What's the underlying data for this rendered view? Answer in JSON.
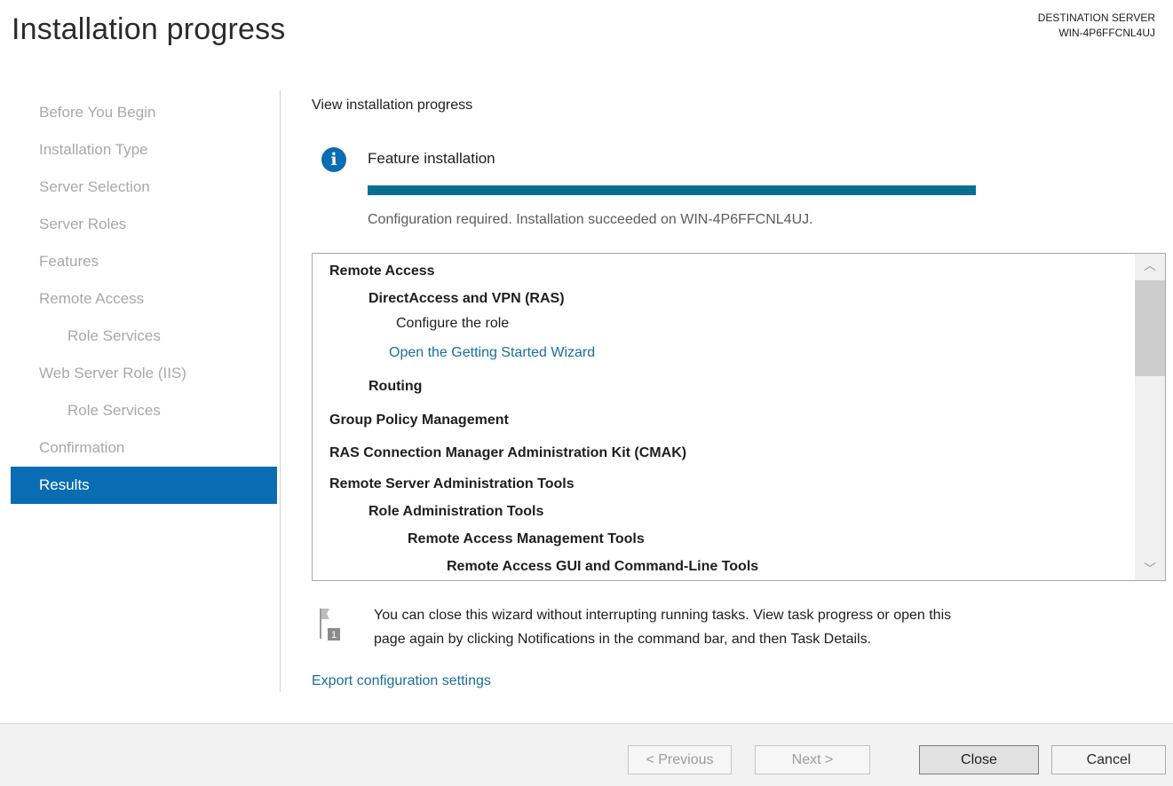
{
  "header": {
    "title": "Installation progress",
    "destination_label": "DESTINATION SERVER",
    "destination_server": "WIN-4P6FFCNL4UJ"
  },
  "nav": {
    "items": [
      {
        "label": "Before You Begin",
        "sub": false,
        "active": false
      },
      {
        "label": "Installation Type",
        "sub": false,
        "active": false
      },
      {
        "label": "Server Selection",
        "sub": false,
        "active": false
      },
      {
        "label": "Server Roles",
        "sub": false,
        "active": false
      },
      {
        "label": "Features",
        "sub": false,
        "active": false
      },
      {
        "label": "Remote Access",
        "sub": false,
        "active": false
      },
      {
        "label": "Role Services",
        "sub": true,
        "active": false
      },
      {
        "label": "Web Server Role (IIS)",
        "sub": false,
        "active": false
      },
      {
        "label": "Role Services",
        "sub": true,
        "active": false
      },
      {
        "label": "Confirmation",
        "sub": false,
        "active": false
      },
      {
        "label": "Results",
        "sub": false,
        "active": true
      }
    ]
  },
  "main": {
    "heading": "View installation progress",
    "feature_label": "Feature installation",
    "progress_percent": 100,
    "status": "Configuration required. Installation succeeded on WIN-4P6FFCNL4UJ.",
    "results": [
      {
        "text": "Remote Access",
        "level": 0,
        "style": "bold"
      },
      {
        "text": "DirectAccess and VPN (RAS)",
        "level": 1,
        "style": "bold"
      },
      {
        "text": "Configure the role",
        "level": 2,
        "style": "normal"
      },
      {
        "text": "Open the Getting Started Wizard",
        "level": 3,
        "style": "link"
      },
      {
        "text": "Routing",
        "level": 1,
        "style": "bold"
      },
      {
        "text": "Group Policy Management",
        "level": 0,
        "style": "bold"
      },
      {
        "text": "RAS Connection Manager Administration Kit (CMAK)",
        "level": 0,
        "style": "bold"
      },
      {
        "text": "Remote Server Administration Tools",
        "level": 0,
        "style": "bold"
      },
      {
        "text": "Role Administration Tools",
        "level": 1,
        "style": "bold"
      },
      {
        "text": "Remote Access Management Tools",
        "level": 4,
        "style": "bold"
      },
      {
        "text": "Remote Access GUI and Command-Line Tools",
        "level": 5,
        "style": "bold"
      }
    ],
    "note_line1": "You can close this wizard without interrupting running tasks. View task progress or open this",
    "note_line2": "page again by clicking Notifications in the command bar, and then Task Details.",
    "flag_badge": "1",
    "export_link": "Export configuration settings"
  },
  "buttons": {
    "previous": "< Previous",
    "next": "Next >",
    "close": "Close",
    "cancel": "Cancel"
  },
  "colors": {
    "accent": "#0a6cb3",
    "progress": "#0a6f8f",
    "link": "#1a6e9d"
  }
}
